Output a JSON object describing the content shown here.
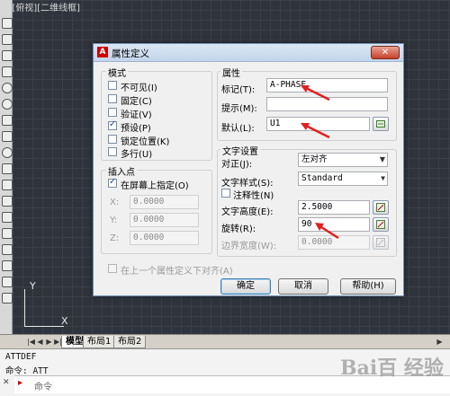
{
  "viewport": {
    "label": "[-][俯视][二维线框]"
  },
  "ucs": {
    "y_label": "Y",
    "x_label": "X"
  },
  "layout_tabs": {
    "items": [
      "模型",
      "布局1",
      "布局2"
    ],
    "active": 0
  },
  "command": {
    "history": [
      "ATTDEF",
      "命令: ATT"
    ],
    "prompt_text": "命令"
  },
  "watermark": "Bai百 经验",
  "dialog": {
    "title": "属性定义",
    "mode": {
      "title": "模式",
      "options": [
        {
          "label": "不可见(I)",
          "checked": false
        },
        {
          "label": "固定(C)",
          "checked": false
        },
        {
          "label": "验证(V)",
          "checked": false
        },
        {
          "label": "预设(P)",
          "checked": true
        },
        {
          "label": "锁定位置(K)",
          "checked": false
        },
        {
          "label": "多行(U)",
          "checked": false
        }
      ]
    },
    "insertion": {
      "title": "插入点",
      "onscreen_label": "在屏幕上指定(O)",
      "onscreen_checked": true,
      "x_label": "X:",
      "x_value": "0.0000",
      "y_label": "Y:",
      "y_value": "0.0000",
      "z_label": "Z:",
      "z_value": "0.0000"
    },
    "attribute": {
      "title": "属性",
      "tag_label": "标记(T):",
      "tag_value": "A-PHASE",
      "prompt_label": "提示(M):",
      "prompt_value": "",
      "default_label": "默认(L):",
      "default_value": "U1"
    },
    "text": {
      "title": "文字设置",
      "justify_label": "对正(J):",
      "justify_value": "左对齐",
      "style_label": "文字样式(S):",
      "style_value": "Standard",
      "annotative_label": "注释性(N)",
      "annotative_checked": false,
      "height_label": "文字高度(E):",
      "height_value": "2.5000",
      "rotation_label": "旋转(R):",
      "rotation_value": "90",
      "boundary_label": "边界宽度(W):",
      "boundary_value": "0.0000"
    },
    "align_below_label": "在上一个属性定义下对齐(A)",
    "buttons": {
      "ok": "确定",
      "cancel": "取消",
      "help": "帮助(H)"
    }
  },
  "colors": {
    "annotation_arrow": "#e02020",
    "canvas": "#2f343c",
    "title_accent": "#c4d5ea"
  }
}
